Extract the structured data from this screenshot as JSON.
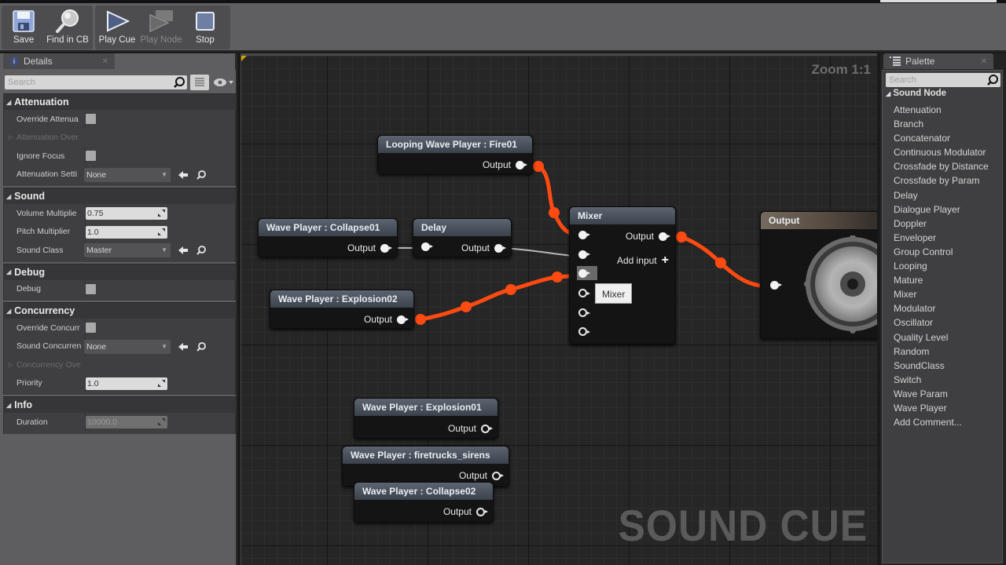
{
  "toolbar": {
    "buttons": [
      {
        "label": "Save",
        "icon": "floppy-disk-icon",
        "enabled": true
      },
      {
        "label": "Find in CB",
        "icon": "magnifier-icon",
        "enabled": true
      },
      {
        "label": "Play Cue",
        "icon": "play-icon",
        "enabled": true
      },
      {
        "label": "Play Node",
        "icon": "play-node-icon",
        "enabled": false
      },
      {
        "label": "Stop",
        "icon": "stop-icon",
        "enabled": true
      }
    ]
  },
  "details": {
    "tab_label": "Details",
    "search_placeholder": "Search",
    "sections": [
      {
        "title": "Attenuation",
        "props": [
          {
            "name": "Override Attenua",
            "type": "checkbox",
            "checked": false
          },
          {
            "name": "Attenuation Over",
            "type": "expander",
            "disabled": true
          },
          {
            "name": "Ignore Focus",
            "type": "checkbox",
            "checked": false
          },
          {
            "name": "Attenuation Setti",
            "type": "asset",
            "value": "None"
          }
        ]
      },
      {
        "title": "Sound",
        "props": [
          {
            "name": "Volume Multiplie",
            "type": "number",
            "value": "0.75"
          },
          {
            "name": "Pitch Multiplier",
            "type": "number",
            "value": "1.0"
          },
          {
            "name": "Sound Class",
            "type": "asset",
            "value": "Master"
          }
        ]
      },
      {
        "title": "Debug",
        "props": [
          {
            "name": "Debug",
            "type": "checkbox",
            "checked": false
          }
        ]
      },
      {
        "title": "Concurrency",
        "props": [
          {
            "name": "Override Concurr",
            "type": "checkbox",
            "checked": false
          },
          {
            "name": "Sound Concurren",
            "type": "asset",
            "value": "None"
          },
          {
            "name": "Concurrency Ove",
            "type": "expander",
            "disabled": true
          },
          {
            "name": "Priority",
            "type": "number",
            "value": "1.0"
          }
        ]
      },
      {
        "title": "Info",
        "props": [
          {
            "name": "Duration",
            "type": "number",
            "value": "10000.0",
            "readonly": true
          }
        ]
      }
    ]
  },
  "graph": {
    "zoom_label": "Zoom 1:1",
    "watermark": "SOUND CUE",
    "wire_color": "#ff4a12",
    "nodes": {
      "looping_fire": {
        "title": "Looping Wave Player : Fire01",
        "output": "Output"
      },
      "collapse01": {
        "title": "Wave Player : Collapse01",
        "output": "Output"
      },
      "delay": {
        "title": "Delay",
        "output": "Output"
      },
      "explosion02": {
        "title": "Wave Player : Explosion02",
        "output": "Output"
      },
      "mixer": {
        "title": "Mixer",
        "output": "Output",
        "add_input": "Add input",
        "input_count": 6
      },
      "output": {
        "title": "Output"
      },
      "explosion01": {
        "title": "Wave Player : Explosion01",
        "output": "Output"
      },
      "sirens": {
        "title": "Wave Player : firetrucks_sirens",
        "output": "Output"
      },
      "collapse02": {
        "title": "Wave Player : Collapse02",
        "output": "Output"
      }
    },
    "tooltip": "Mixer"
  },
  "palette": {
    "tab_label": "Palette",
    "search_placeholder": "Search",
    "category": "Sound Node",
    "items": [
      "Attenuation",
      "Branch",
      "Concatenator",
      "Continuous Modulator",
      "Crossfade by Distance",
      "Crossfade by Param",
      "Delay",
      "Dialogue Player",
      "Doppler",
      "Enveloper",
      "Group Control",
      "Looping",
      "Mature",
      "Mixer",
      "Modulator",
      "Oscillator",
      "Quality Level",
      "Random",
      "SoundClass",
      "Switch",
      "Wave Param",
      "Wave Player",
      "Add Comment..."
    ]
  }
}
